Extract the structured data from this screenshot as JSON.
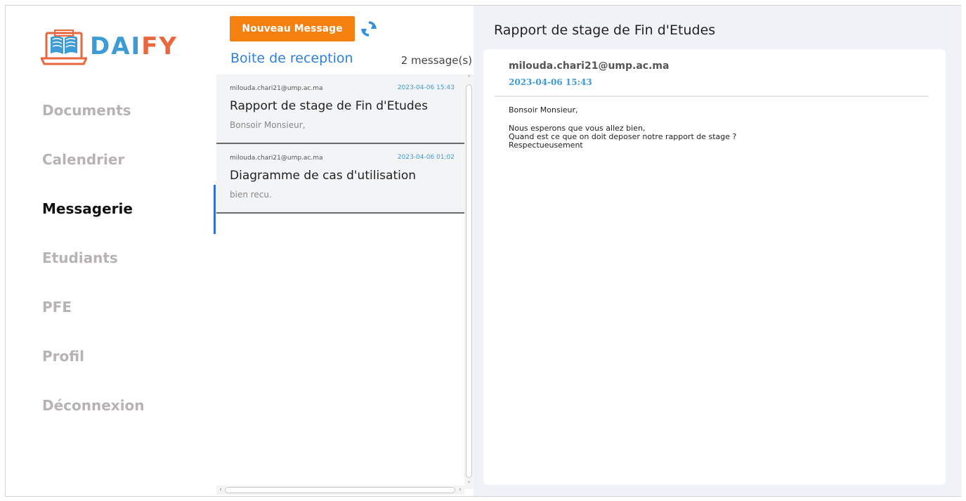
{
  "brand": {
    "name_part1": "DA",
    "name_part2": "I",
    "name_part3": "FY",
    "colors": {
      "blue": "#3d9bd6",
      "orange": "#e9673f"
    },
    "icon": "laptop-book-icon"
  },
  "sidebar": {
    "items": [
      {
        "label": "Documents",
        "active": false
      },
      {
        "label": "Calendrier",
        "active": false
      },
      {
        "label": "Messagerie",
        "active": true
      },
      {
        "label": "Etudiants",
        "active": false
      },
      {
        "label": "PFE",
        "active": false
      },
      {
        "label": "Profil",
        "active": false
      },
      {
        "label": "Déconnexion",
        "active": false
      }
    ],
    "active_color": "#2f6fe0"
  },
  "toolbar": {
    "new_message_label": "Nouveau Message",
    "new_message_color": "#f4800f",
    "refresh_icon": "refresh-icon"
  },
  "inbox": {
    "title": "Boite de reception",
    "count_label": "2 message(s)",
    "messages": [
      {
        "from": "milouda.chari21@ump.ac.ma",
        "date": "2023-04-06 15:43",
        "subject": "Rapport de stage de Fin d'Etudes",
        "preview": "Bonsoir Monsieur,"
      },
      {
        "from": "milouda.chari21@ump.ac.ma",
        "date": "2023-04-06 01:02",
        "subject": "Diagramme de cas d'utilisation",
        "preview": "bien recu."
      }
    ]
  },
  "reader": {
    "title": "Rapport de stage de Fin d'Etudes",
    "from": "milouda.chari21@ump.ac.ma",
    "date": "2023-04-06 15:43",
    "body_line1": "Bonsoir Monsieur,",
    "body_line2": "Nous esperons que vous allez bien,",
    "body_line3": "Quand est ce que on doit deposer notre rapport de stage ?",
    "body_line4": "Respectueusement"
  }
}
